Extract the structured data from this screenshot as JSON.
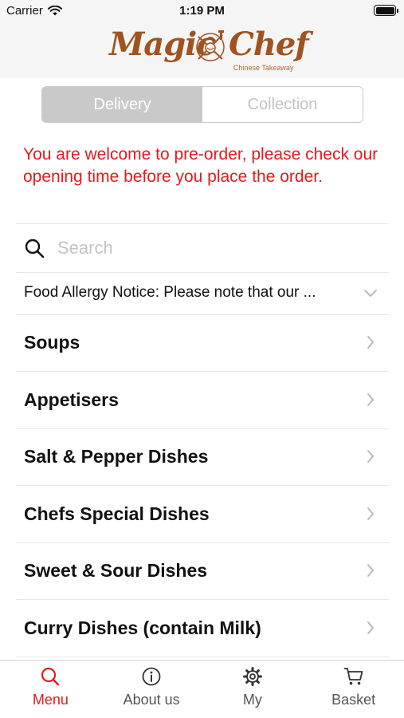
{
  "status_bar": {
    "carrier": "Carrier",
    "time": "1:19 PM"
  },
  "header": {
    "brand_word_1": "Magic",
    "brand_word_2": "Chef",
    "tagline": "Chinese Takeaway",
    "brand_color": "#a0521f"
  },
  "order_type": {
    "options": [
      "Delivery",
      "Collection"
    ],
    "selected": "Delivery"
  },
  "notice": {
    "text": "You are welcome to pre-order, please check our opening time before you place the order.",
    "color": "#e8191d"
  },
  "search": {
    "placeholder": "Search",
    "value": ""
  },
  "allergy_notice": {
    "text": "Food Allergy Notice: Please note that our ..."
  },
  "categories": [
    {
      "label": "Soups"
    },
    {
      "label": "Appetisers"
    },
    {
      "label": "Salt & Pepper Dishes"
    },
    {
      "label": "Chefs Special Dishes"
    },
    {
      "label": "Sweet & Sour Dishes"
    },
    {
      "label": "Curry Dishes (contain Milk)"
    }
  ],
  "tabbar": {
    "active_tab": "Menu",
    "accent_color": "#e8191d",
    "items": [
      {
        "label": "Menu",
        "icon": "search-icon"
      },
      {
        "label": "About us",
        "icon": "info-icon"
      },
      {
        "label": "My",
        "icon": "gear-icon"
      },
      {
        "label": "Basket",
        "icon": "cart-icon"
      }
    ]
  }
}
